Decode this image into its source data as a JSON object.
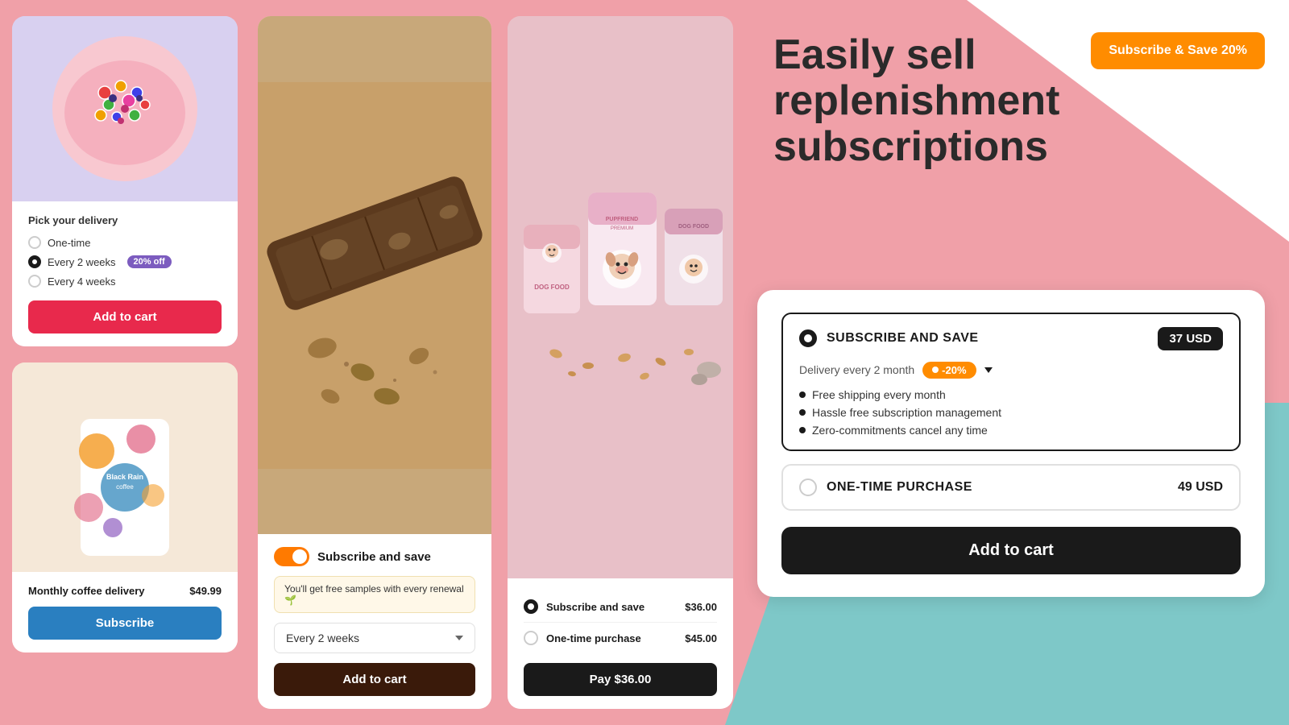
{
  "background": {
    "pink": "#f0a0a8",
    "teal": "#7ec8c8",
    "white_triangle": "#ffffff"
  },
  "hero": {
    "title_line1": "Easily sell replenishment",
    "title_line2": "subscriptions",
    "subscribe_save_button": "Subscribe & Save 20%"
  },
  "card_cereal": {
    "delivery_label": "Pick your delivery",
    "options": [
      {
        "label": "One-time",
        "selected": false
      },
      {
        "label": "Every 2 weeks",
        "selected": true,
        "badge": "20% off"
      },
      {
        "label": "Every 4 weeks",
        "selected": false
      }
    ],
    "add_to_cart_label": "Add to cart"
  },
  "card_coffee": {
    "product_name": "Monthly coffee delivery",
    "product_price": "$49.99",
    "subscribe_label": "Subscribe"
  },
  "card_choc": {
    "toggle_label": "Subscribe and save",
    "free_samples_text": "You'll get free samples with every renewal 🌱",
    "frequency_label": "Every 2 weeks",
    "add_to_cart_label": "Add to cart"
  },
  "card_dog": {
    "options": [
      {
        "label": "Subscribe and save",
        "price": "$36.00",
        "selected": true
      },
      {
        "label": "One-time purchase",
        "price": "$45.00",
        "selected": false
      }
    ],
    "pay_button_prefix": "Pay ",
    "pay_amount": "$36.00"
  },
  "widget": {
    "subscribe_option": {
      "title": "SUBSCRIBE AND SAVE",
      "price": "37 USD",
      "selected": true,
      "delivery_label": "Delivery every 2 month",
      "discount_label": "-20%",
      "benefits": [
        "Free shipping every month",
        "Hassle free subscription management",
        "Zero-commitments cancel any time"
      ]
    },
    "onetime_option": {
      "title": "ONE-TIME PURCHASE",
      "price": "49 USD",
      "selected": false
    },
    "add_to_cart_label": "Add to cart"
  }
}
